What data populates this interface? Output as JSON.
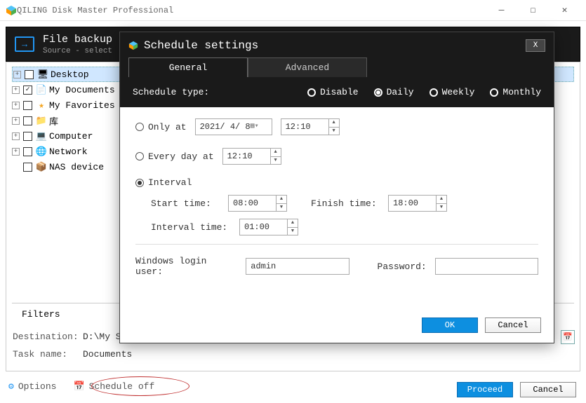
{
  "window": {
    "title": "QILING Disk Master Professional"
  },
  "header": {
    "title": "File backup",
    "subtitle": "Source - select"
  },
  "tree": {
    "items": [
      {
        "label": "Desktop",
        "checked": false,
        "selected": true,
        "icon": "desktop"
      },
      {
        "label": "My Documents",
        "checked": true,
        "selected": false,
        "icon": "doc"
      },
      {
        "label": "My Favorites",
        "checked": false,
        "selected": false,
        "icon": "star"
      },
      {
        "label": "库",
        "checked": false,
        "selected": false,
        "icon": "lib"
      },
      {
        "label": "Computer",
        "checked": false,
        "selected": false,
        "icon": "computer"
      },
      {
        "label": "Network",
        "checked": false,
        "selected": false,
        "icon": "network"
      },
      {
        "label": "NAS device",
        "checked": false,
        "selected": false,
        "icon": "nas"
      }
    ]
  },
  "filters_label": "Filters",
  "destination": {
    "label": "Destination:",
    "value": "D:\\My Sto"
  },
  "taskname": {
    "label": "Task name:",
    "value": "Documents"
  },
  "options": {
    "options_label": "Options",
    "schedule_label": "Schedule off"
  },
  "buttons": {
    "proceed": "Proceed",
    "cancel": "Cancel"
  },
  "modal": {
    "title": "Schedule settings",
    "tabs": {
      "general": "General",
      "advanced": "Advanced"
    },
    "schedule_type_label": "Schedule type:",
    "types": {
      "disable": "Disable",
      "daily": "Daily",
      "weekly": "Weekly",
      "monthly": "Monthly"
    },
    "selected_type": "Daily",
    "only_at": {
      "label": "Only at",
      "date": "2021/ 4/ 8",
      "time": "12:10"
    },
    "every_day": {
      "label": "Every day at",
      "time": "12:10"
    },
    "interval": {
      "label": "Interval",
      "start_label": "Start time:",
      "start": "08:00",
      "finish_label": "Finish time:",
      "finish": "18:00",
      "interval_label": "Interval time:",
      "interval": "01:00"
    },
    "selected_mode": "Interval",
    "auth": {
      "user_label": "Windows login user:",
      "user": "admin",
      "password_label": "Password:",
      "password": ""
    },
    "buttons": {
      "ok": "OK",
      "cancel": "Cancel"
    }
  }
}
